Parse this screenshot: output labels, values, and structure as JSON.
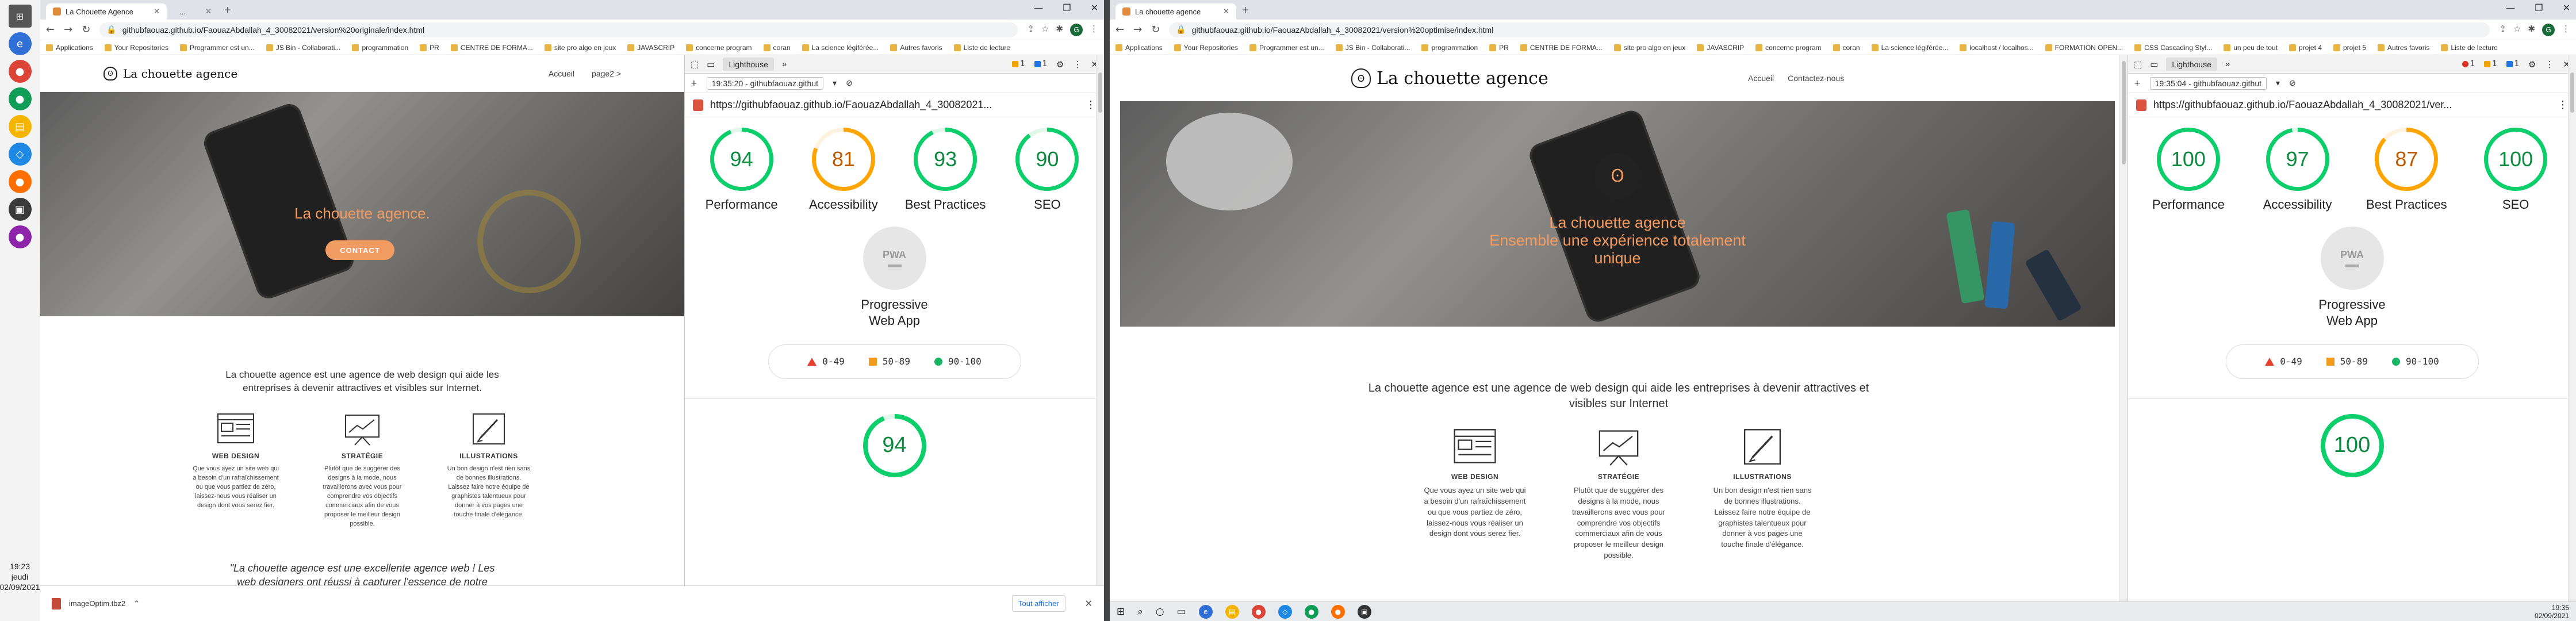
{
  "taskbar_left": {
    "time": "19:23",
    "day": "jeudi",
    "date": "02/09/2021"
  },
  "left_window": {
    "tab_title": "La Chouette Agence",
    "tab2_title": "...",
    "url": "githubfaouaz.github.io/FaouazAbdallah_4_30082021/version%20originale/index.html",
    "bookmarks": [
      "Applications",
      "Your Repositories",
      "Programmer est un...",
      "JS Bin - Collaborati...",
      "programmation",
      "PR",
      "CENTRE DE FORMA...",
      "site pro algo en jeux",
      "JAVASCRIP",
      "concerne program",
      "coran",
      "La science légiférée...",
      "Autres favoris",
      "Liste de lecture"
    ],
    "site": {
      "logo_text": "La chouette agence",
      "menu": [
        "Accueil",
        "page2 >"
      ],
      "hero_title": "La chouette agence.",
      "cta": "CONTACT",
      "intro": "La chouette agence est une agence de web design qui aide les entreprises à devenir attractives et visibles sur Internet.",
      "services": [
        {
          "title": "WEB DESIGN",
          "text": "Que vous ayez un site web qui a besoin d'un rafraîchissement ou que vous partiez de zéro, laissez-nous vous réaliser un design dont vous serez fier."
        },
        {
          "title": "STRATÉGIE",
          "text": "Plutôt que de suggérer des designs à la mode, nous travaillerons avec vous pour comprendre vos objectifs commerciaux afin de vous proposer le meilleur design possible."
        },
        {
          "title": "ILLUSTRATIONS",
          "text": "Un bon design n'est rien sans de bonnes illustrations. Laissez faire notre équipe de graphistes talentueux pour donner à vos pages une touche finale d'élégance."
        }
      ],
      "quote": "\"La chouette agence est une excellente agence web ! Les web designers ont réussi à capturer l'essence de notre"
    },
    "devtools": {
      "panel": "Lighthouse",
      "warn_count": "1",
      "info_count": "1",
      "report_time": "19:35:20 - githubfaouaz.githut",
      "url": "https://githubfaouaz.github.io/FaouazAbdallah_4_30082021...",
      "scores": [
        {
          "value": "94",
          "label": "Performance",
          "level": "good"
        },
        {
          "value": "81",
          "label": "Accessibility",
          "level": "average"
        },
        {
          "value": "93",
          "label": "Best Practices",
          "level": "good"
        },
        {
          "value": "90",
          "label": "SEO",
          "level": "good"
        }
      ],
      "pwa_label": "Progressive Web App",
      "pwa_icon_text": "PWA",
      "legend": [
        "0-49",
        "50-89",
        "90-100"
      ],
      "section_score": "94"
    },
    "download": {
      "file": "imageOptim.tbz2",
      "show_all": "Tout afficher"
    }
  },
  "right_window": {
    "tab_title": "La chouette agence",
    "url": "githubfaouaz.github.io/FaouazAbdallah_4_30082021/version%20optimise/index.html",
    "bookmarks": [
      "Applications",
      "Your Repositories",
      "Programmer est un...",
      "JS Bin - Collaborati...",
      "programmation",
      "PR",
      "CENTRE DE FORMA...",
      "site pro algo en jeux",
      "JAVASCRIP",
      "concerne program",
      "coran",
      "La science légiférée...",
      "localhost / localhos...",
      "FORMATION OPEN...",
      "CSS Cascading Styl...",
      "un peu de tout",
      "projet 4",
      "projet 5",
      "Autres favoris",
      "Liste de lecture"
    ],
    "site": {
      "logo_text": "La chouette agence",
      "menu": [
        "Accueil",
        "Contactez-nous"
      ],
      "hero_title": "La chouette agence",
      "hero_subtitle": "Ensemble une expérience totalement unique",
      "intro": "La chouette agence est une agence de web design qui aide les entreprises à devenir attractives et visibles sur Internet",
      "services": [
        {
          "title": "WEB DESIGN",
          "text": "Que vous ayez un site web qui a besoin d'un rafraîchissement ou que vous partiez de zéro, laissez-nous vous réaliser un design dont vous serez fier."
        },
        {
          "title": "STRATÉGIE",
          "text": "Plutôt que de suggérer des designs à la mode, nous travaillerons avec vous pour comprendre vos objectifs commerciaux afin de vous proposer le meilleur design possible."
        },
        {
          "title": "ILLUSTRATIONS",
          "text": "Un bon design n'est rien sans de bonnes illustrations. Laissez faire notre équipe de graphistes talentueux pour donner à vos pages une touche finale d'élégance."
        }
      ]
    },
    "devtools": {
      "panel": "Lighthouse",
      "error_count": "1",
      "warn_count": "1",
      "info_count": "1",
      "report_time": "19:35:04 - githubfaouaz.githut",
      "url": "https://githubfaouaz.github.io/FaouazAbdallah_4_30082021/ver...",
      "scores": [
        {
          "value": "100",
          "label": "Performance",
          "level": "good"
        },
        {
          "value": "97",
          "label": "Accessibility",
          "level": "good"
        },
        {
          "value": "87",
          "label": "Best Practices",
          "level": "average"
        },
        {
          "value": "100",
          "label": "SEO",
          "level": "good"
        }
      ],
      "pwa_label": "Progressive Web App",
      "pwa_icon_text": "PWA",
      "legend": [
        "0-49",
        "50-89",
        "90-100"
      ],
      "section_score": "100"
    },
    "taskbar": {
      "time": "19:35",
      "date": "02/09/2021"
    }
  },
  "colors": {
    "good": "#0cce6b",
    "average": "#ffa400",
    "poor": "#ff4e42",
    "accent": "#f29b62"
  }
}
